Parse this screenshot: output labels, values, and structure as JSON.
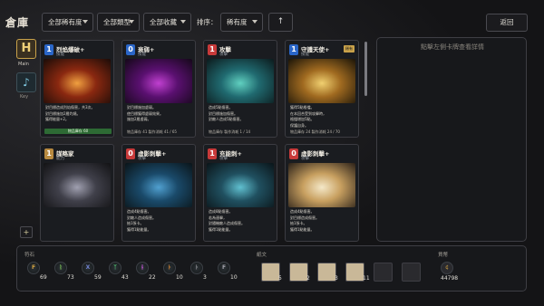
{
  "header": {
    "title": "倉庫",
    "filter_rarity": "全部稀有度",
    "filter_type": "全部類型",
    "filter_collection": "全部收藏",
    "sort_label": "排序：",
    "sort_value": "稀有度",
    "sort_direction": "↑",
    "back_label": "返回"
  },
  "nav": {
    "main_label": "Main",
    "main_glyph": "H",
    "key_label": "Key",
    "key_glyph": "♪",
    "add_glyph": "+"
  },
  "cards": [
    {
      "cost": "1",
      "cost_color": "#2a66c8",
      "name": "烈焰爆破+",
      "type": "技能",
      "badge": "",
      "art": [
        "#f0a040",
        "#8a2810",
        "#1a0c08"
      ],
      "desc": [
        "對目標造成烈焰傷害，共3次。",
        "對目標施加2層灼燒。",
        "獲得能量+2。"
      ],
      "bar": "物品庫存 60"
    },
    {
      "cost": "0",
      "cost_color": "#2a66c8",
      "name": "衰弱+",
      "type": "技能",
      "badge": "",
      "art": [
        "#c040d0",
        "#5a1070",
        "#140818"
      ],
      "desc": [
        "對目標施加虛弱。",
        "使目標獲得虛弱效果。",
        "施加2層虛弱。"
      ],
      "foot": "物品庫存 41   製作消耗 41 / 65"
    },
    {
      "cost": "1",
      "cost_color": "#c83a3a",
      "name": "攻擊",
      "type": "攻擊",
      "badge": "",
      "art": [
        "#60d0c0",
        "#206a70",
        "#0c1a1c"
      ],
      "desc": [
        "造成5點傷害。",
        "對目標施加傷害。",
        "對敵人造成5點傷害。"
      ],
      "foot": "物品庫存   製作消耗 1 / 14"
    },
    {
      "cost": "1",
      "cost_color": "#2a66c8",
      "name": "守護天使+",
      "type": "技能",
      "badge": "稀有",
      "art": [
        "#f0d070",
        "#a06a20",
        "#1a1408"
      ],
      "desc": [
        "獲得5點格擋。",
        "在本回合受到攻擊時，",
        "格擋增加5點。",
        "保護自身。"
      ],
      "foot": "物品庫存 24   製作消耗 24 / 70"
    },
    {
      "cost": "1",
      "cost_color": "#b88a40",
      "name": "謀略家",
      "type": "能力",
      "badge": "",
      "art": [
        "#a0a0b0",
        "#40404a",
        "#121214"
      ],
      "desc": [],
      "foot": ""
    },
    {
      "cost": "0",
      "cost_color": "#c83a3a",
      "name": "虛影刺擊+",
      "type": "攻擊",
      "badge": "",
      "art": [
        "#50a0d0",
        "#1a4a6a",
        "#0a1418"
      ],
      "desc": [
        "造成4點傷害。",
        "對敵人造成傷害。",
        "抽1張卡。",
        "獲得1點能量。"
      ],
      "foot": ""
    },
    {
      "cost": "1",
      "cost_color": "#c83a3a",
      "name": "充能刺+",
      "type": "攻擊",
      "badge": "",
      "art": [
        "#60c0d0",
        "#205060",
        "#0a1418"
      ],
      "desc": [
        "造成8點傷害。",
        "若為連擊，",
        "對隨機敵人造成傷害。",
        "獲得1點能量。"
      ],
      "foot": ""
    },
    {
      "cost": "0",
      "cost_color": "#c83a3a",
      "name": "虛影刺擊+",
      "type": "攻擊",
      "badge": "",
      "art": [
        "#f4e8c8",
        "#c8a060",
        "#2a2018"
      ],
      "desc": [
        "造成4點傷害。",
        "對目標造成傷害。",
        "抽1張卡。",
        "獲得1點能量。"
      ],
      "foot": ""
    }
  ],
  "detail": {
    "hint": "點擊左側卡牌查看詳情"
  },
  "inventory": {
    "runes_label": "符石",
    "runes": [
      {
        "glyph": "F",
        "color": "#d0a040",
        "count": "69"
      },
      {
        "glyph": "ᚱ",
        "color": "#70b050",
        "count": "73"
      },
      {
        "glyph": "X",
        "color": "#7080d0",
        "count": "59"
      },
      {
        "glyph": "ᛉ",
        "color": "#50c070",
        "count": "43"
      },
      {
        "glyph": "ᚺ",
        "color": "#b050c0",
        "count": "22"
      },
      {
        "glyph": "ᚦ",
        "color": "#d08030",
        "count": "10"
      },
      {
        "glyph": "ᚦ",
        "color": "#8a8a90",
        "count": "3"
      },
      {
        "glyph": "F",
        "color": "#a0a0a8",
        "count": "10"
      }
    ],
    "scrolls_label": "紙文",
    "scrolls": [
      {
        "count": "5",
        "empty": false
      },
      {
        "count": "2",
        "empty": false
      },
      {
        "count": "3",
        "empty": false
      },
      {
        "count": "11",
        "empty": false
      },
      {
        "count": "",
        "empty": true
      },
      {
        "count": "",
        "empty": true
      }
    ],
    "gold_label": "貨幣",
    "gold_glyph": "¢",
    "gold": "44798"
  }
}
